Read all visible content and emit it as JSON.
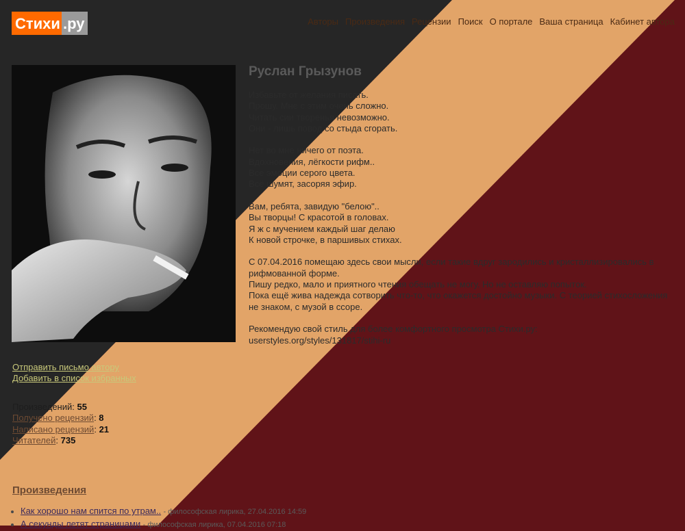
{
  "site": {
    "logo_part1": "Стихи",
    "logo_part2": ".ру"
  },
  "nav": [
    {
      "label": "Авторы"
    },
    {
      "label": "Произведения"
    },
    {
      "label": "Рецензии"
    },
    {
      "label": "Поиск"
    },
    {
      "label": "О портале"
    },
    {
      "label": "Ваша страница"
    },
    {
      "label": "Кабинет автора"
    }
  ],
  "author": {
    "name": "Руслан Грызунов",
    "bio": "Избавьте от желания писать.\nПрошу. Мне с этим очень сложно.\nЧитать сии творенья невозможно.\nОни - лишь повод со стыда сгорать.\n\nНет во мне ничего от поэта.\nВдохновения, лёгкости рифм..\nВсе эмоции серого цвета.\nВсё шумят, засоряя эфир.\n\nВам, ребята, завидую \"белою\"..\nВы творцы! С красотой в головах.\nЯ ж с мучением каждый шаг делаю\nК новой строчке, в паршивых стихах.\n\nС 07.04.2016 помещаю здесь свои мысли, если такие вдруг зародились и кристаллизировались в рифмованной форме.\nПишу редко, мало и приятного чтения обещать не могу. Но не оставляю попыток.\nПока ещё жива надежда сотворить что-то, что окажется достойно музыки. С теорией стихосложения не знаком, с музой в ссоре.\n\nРекомендую свой стиль для более комфортного просмотра Стихи.ру:\nuserstyles.org/styles/131817/stihi-ru"
  },
  "actions": {
    "send_letter": "Отправить письмо автору",
    "add_favorites": "Добавить в список избранных"
  },
  "stats": {
    "works_label": "Произведений",
    "works_count": "55",
    "received_label": "Получено рецензий",
    "received_count": "8",
    "written_label": "Написано рецензий",
    "written_count": "21",
    "readers_label": "Читателей",
    "readers_count": "735"
  },
  "works_section": {
    "title": "Произведения",
    "items": [
      {
        "title": "Как хорошо нам спится по утрам..",
        "meta": "- философская лирика, 27.04.2016 14:59"
      },
      {
        "title": "А секунды летят страницами",
        "meta": "- философская лирика, 07.04.2016 07:18"
      }
    ]
  },
  "colors": {
    "dark_band": "#262626",
    "tan_band": "#e2a468",
    "maroon_band": "#601318",
    "logo_orange": "#ff6a00"
  }
}
